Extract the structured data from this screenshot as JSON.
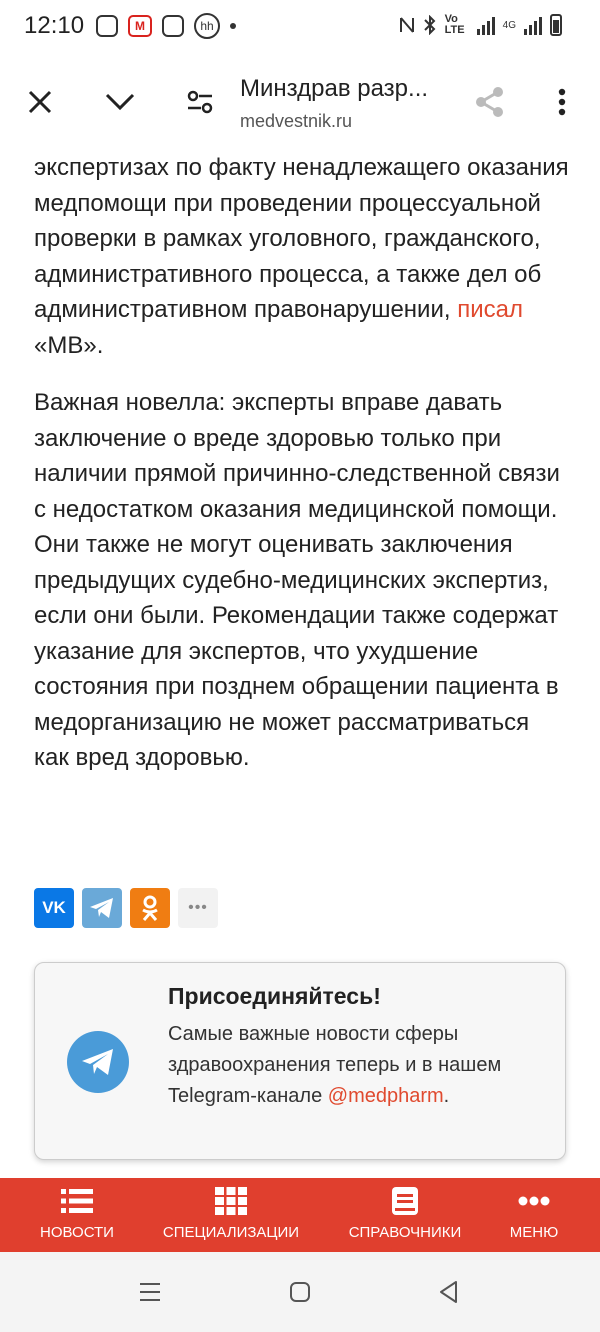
{
  "status_bar": {
    "time": "12:10",
    "carrier_text": "Vo LTE",
    "network": "4G",
    "icons": [
      "instagram-icon",
      "magnit-icon",
      "instagram-icon",
      "hh-icon",
      "dot-icon",
      "nfc-icon",
      "bluetooth-icon",
      "signal-icon",
      "battery-icon"
    ]
  },
  "toolbar": {
    "title": "Минздрав разр...",
    "url": "medvestnik.ru",
    "icons": [
      "close-icon",
      "chevron-down-icon",
      "tune-icon",
      "share-icon",
      "more-vert-icon"
    ]
  },
  "article": {
    "p1_text": "экспертизах по факту ненадлежащего оказания медпомощи при проведении процессуальной проверки в рамках уголовного, гражданского, административного процесса, а также дел об административном правонарушении,",
    "p1_link": "писал",
    "p1_tail": "«МВ».",
    "p2_text": "Важная новелла: эксперты вправе давать заключение о вреде здоровью только при наличии прямой причинно-следственной связи с недостатком оказания медицинской помощи. Они также не могут оценивать заключения предыдущих судебно-медицинских экспертиз, если они были. Рекомендации также содержат указание для экспертов, что ухудшение состояния при позднем обращении пациента в медорганизацию не может рассматриваться как вред здоровью."
  },
  "share": {
    "vk_label": "VK",
    "more_label": "•••",
    "icons": [
      "vk-icon",
      "telegram-icon",
      "odnoklassniki-icon",
      "more-icon"
    ]
  },
  "card": {
    "title": "Присоединяйтесь!",
    "text": "Самые важные новости сферы здравоохранения теперь и в нашем Telegram-канале",
    "link": "@medpharm",
    "after_link": "."
  },
  "bottom_nav": {
    "items": [
      {
        "label": "НОВОСТИ",
        "icon": "list-icon"
      },
      {
        "label": "СПЕЦИАЛИЗАЦИИ",
        "icon": "grid-icon"
      },
      {
        "label": "СПРАВОЧНИКИ",
        "icon": "book-icon"
      },
      {
        "label": "МЕНЮ",
        "icon": "dots-icon"
      }
    ]
  },
  "colors": {
    "accent": "#e03f2e",
    "link": "#e04a2f",
    "telegram": "#4a9bd8",
    "vk": "#0a78e6",
    "ok": "#f07d12"
  }
}
